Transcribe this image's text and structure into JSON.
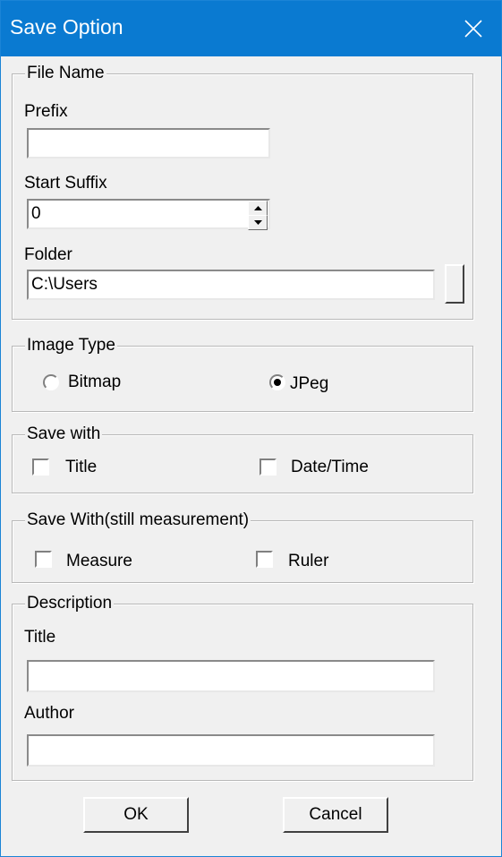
{
  "window": {
    "title": "Save Option",
    "colors": {
      "titlebar": "#0a7ad1",
      "face": "#f0f0f0"
    }
  },
  "file_name": {
    "group_label": "File Name",
    "prefix_label": "Prefix",
    "prefix_value": "",
    "start_suffix_label": "Start Suffix",
    "start_suffix_value": "0",
    "folder_label": "Folder",
    "folder_value": "C:\\Users"
  },
  "image_type": {
    "group_label": "Image Type",
    "options": [
      {
        "label": "Bitmap",
        "selected": false
      },
      {
        "label": "JPeg",
        "selected": true
      }
    ]
  },
  "save_with": {
    "group_label": "Save with",
    "options": [
      {
        "label": "Title",
        "checked": false
      },
      {
        "label": "Date/Time",
        "checked": false
      }
    ]
  },
  "save_with_measurement": {
    "group_label": "Save With(still measurement)",
    "options": [
      {
        "label": "Measure",
        "checked": false
      },
      {
        "label": "Ruler",
        "checked": false
      }
    ]
  },
  "description": {
    "group_label": "Description",
    "title_label": "Title",
    "title_value": "",
    "author_label": "Author",
    "author_value": ""
  },
  "buttons": {
    "ok": "OK",
    "cancel": "Cancel"
  },
  "icons": {
    "close": "close-icon",
    "spin_up": "up-arrow-icon",
    "spin_down": "down-arrow-icon"
  }
}
